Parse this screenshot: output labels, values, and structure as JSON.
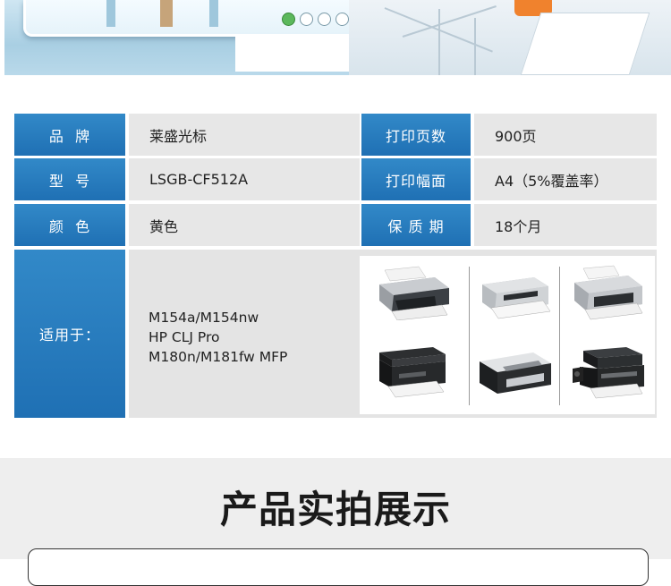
{
  "spec": {
    "brand_label": "品  牌",
    "brand_value": "莱盛光标",
    "pages_label": "打印页数",
    "pages_value": "900页",
    "model_label": "型  号",
    "model_value": "LSGB-CF512A",
    "coverage_label": "打印幅面",
    "coverage_value": "A4（5%覆盖率）",
    "color_label": "颜  色",
    "color_value": "黄色",
    "warranty_label": "保 质 期",
    "warranty_value": "18个月",
    "applicable_label": "适用于：",
    "applicable_models": [
      "M154a/M154nw",
      "HP CLJ Pro",
      "M180n/M181fw  MFP"
    ]
  },
  "printers": [
    {
      "icon": "laser-printer-icon"
    },
    {
      "icon": "laser-printer-icon"
    },
    {
      "icon": "laser-printer-icon"
    },
    {
      "icon": "mfp-printer-icon"
    },
    {
      "icon": "laser-printer-icon"
    },
    {
      "icon": "mfp-printer-icon"
    }
  ],
  "section": {
    "title": "产品实拍展示"
  },
  "colors": {
    "label_blue": "#2478bd",
    "value_gray": "#e7e7e7"
  }
}
